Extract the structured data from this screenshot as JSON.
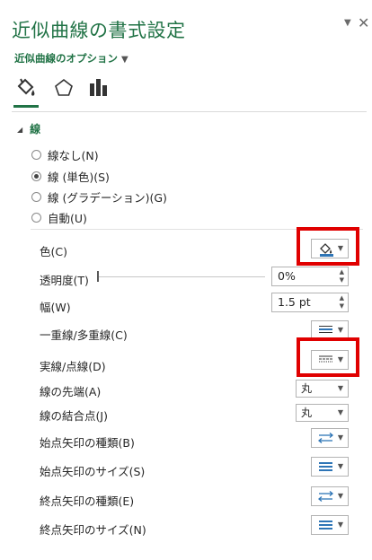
{
  "pane": {
    "title": "近似曲線の書式設定",
    "options_label": "近似曲線のオプション"
  },
  "tabs": [
    {
      "icon": "paint-bucket-icon"
    },
    {
      "icon": "pentagon-icon"
    },
    {
      "icon": "bar-chart-icon"
    }
  ],
  "section": {
    "title": "線"
  },
  "line_options": [
    {
      "label": "線なし(N)",
      "selected": false
    },
    {
      "label": "線 (単色)(S)",
      "selected": true
    },
    {
      "label": "線 (グラデーション)(G)",
      "selected": false
    },
    {
      "label": "自動(U)",
      "selected": false
    }
  ],
  "props": {
    "color": {
      "label": "色(C)",
      "swatch": "#2e75b6"
    },
    "transparency": {
      "label": "透明度(T)",
      "value": "0%"
    },
    "width": {
      "label": "幅(W)",
      "value": "1.5 pt"
    },
    "compound": {
      "label": "一重線/多重線(C)"
    },
    "dash": {
      "label": "実線/点線(D)"
    },
    "cap": {
      "label": "線の先端(A)",
      "value": "丸"
    },
    "join": {
      "label": "線の結合点(J)",
      "value": "丸"
    },
    "begin_arrow_type": {
      "label": "始点矢印の種類(B)"
    },
    "begin_arrow_size": {
      "label": "始点矢印のサイズ(S)"
    },
    "end_arrow_type": {
      "label": "終点矢印の種類(E)"
    },
    "end_arrow_size": {
      "label": "終点矢印のサイズ(N)"
    }
  },
  "colors": {
    "accent": "#217346",
    "highlight": "#e00000"
  }
}
